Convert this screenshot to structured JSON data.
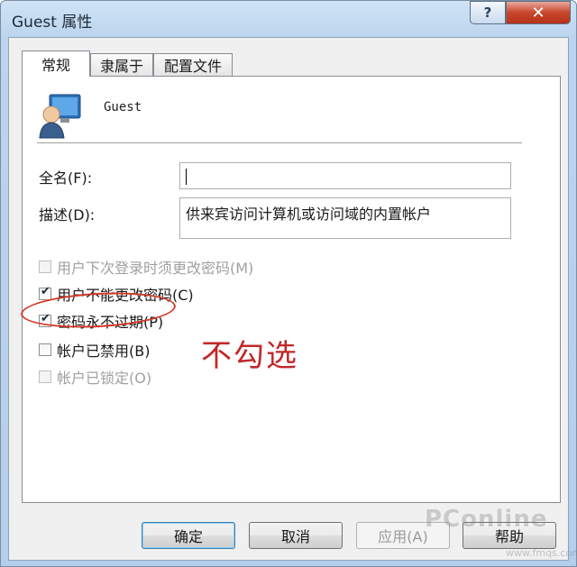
{
  "window": {
    "title": "Guest 属性",
    "help_label": "?",
    "close_label": "✕"
  },
  "tabs": [
    {
      "label": "常规"
    },
    {
      "label": "隶属于"
    },
    {
      "label": "配置文件"
    }
  ],
  "general": {
    "username": "Guest",
    "fullname_label": "全名(F):",
    "fullname_value": "",
    "description_label": "描述(D):",
    "description_value": "供来宾访问计算机或访问域的内置帐户"
  },
  "checkboxes": [
    {
      "label": "用户下次登录时须更改密码(M)",
      "checked": false,
      "disabled": true
    },
    {
      "label": "用户不能更改密码(C)",
      "checked": true,
      "disabled": false
    },
    {
      "label": "密码永不过期(P)",
      "checked": true,
      "disabled": false
    },
    {
      "label": "帐户已禁用(B)",
      "checked": false,
      "disabled": false
    },
    {
      "label": "帐户已锁定(O)",
      "checked": false,
      "disabled": true
    }
  ],
  "annotation": {
    "text": "不勾选",
    "color": "#c0282a"
  },
  "buttons": {
    "ok": "确定",
    "cancel": "取消",
    "apply": "应用(A)",
    "help": "帮助"
  },
  "watermark": {
    "text": "PConline",
    "sub": "www.fmqs.com"
  }
}
